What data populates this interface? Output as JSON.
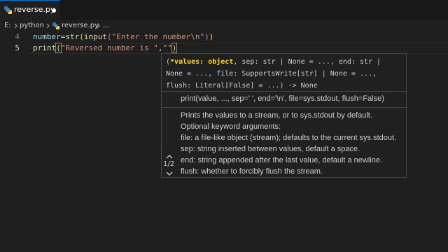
{
  "tab": {
    "filename": "reverse.py",
    "dirty_indicator": "●"
  },
  "breadcrumb": {
    "drive": "E:",
    "folder": "python",
    "file": "reverse.py",
    "ellipsis": "..."
  },
  "editor": {
    "lines": [
      {
        "number": "4",
        "tokens": [
          "number",
          "=",
          "str",
          "(",
          "input",
          "(",
          "\"Enter the number\\n\"",
          ")",
          ")"
        ]
      },
      {
        "number": "5",
        "tokens": [
          "print",
          "(",
          "\"Reversed number is \"",
          ",",
          "\"\"",
          ")"
        ]
      }
    ]
  },
  "hover": {
    "signature_lines": [
      "(*values: object, sep: str | None = ..., end: str |",
      "None = ..., file: SupportsWrite[str] | None = ...,",
      "flush: Literal[False] = ...) -> None"
    ],
    "active_parameter": "*values: object",
    "pager": "1/2",
    "doc_signature": "print(value, ..., sep=' ', end='\\n', file=sys.stdout, flush=False)",
    "doc_lines": [
      "Prints the values to a stream, or to sys.stdout by default.",
      "Optional keyword arguments:",
      "file: a file-like object (stream); defaults to the current sys.stdout.",
      "sep: string inserted between values, default a space.",
      "end: string appended after the last value, default a newline.",
      "flush: whether to forcibly flush the stream."
    ]
  },
  "colors": {
    "accent": "#0078d4",
    "variable": "#9cdcfe",
    "function": "#dcdcaa",
    "string": "#ce9178",
    "bracket_level1": "#ffd700",
    "bracket_level2": "#da70d6"
  },
  "icons": [
    "python-file-icon",
    "chevron-right-icon",
    "chevron-up-icon",
    "chevron-down-icon"
  ]
}
